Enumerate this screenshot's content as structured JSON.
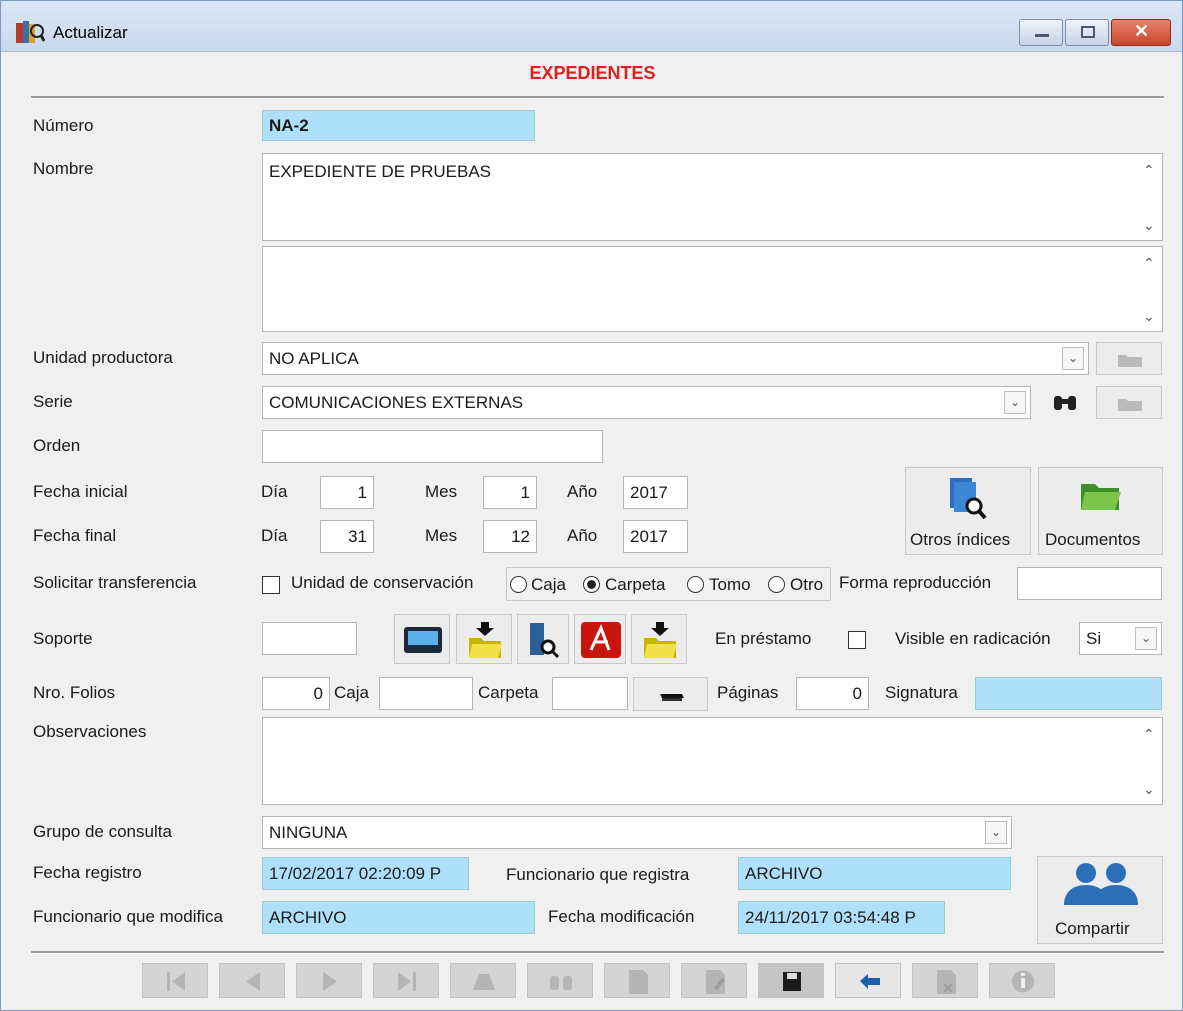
{
  "window": {
    "title": "Actualizar",
    "heading": "EXPEDIENTES"
  },
  "form": {
    "numero_label": "Número",
    "numero_value": "NA-2",
    "nombre_label": "Nombre",
    "nombre_value": "EXPEDIENTE DE PRUEBAS",
    "unidad_label": "Unidad productora",
    "unidad_value": "NO APLICA",
    "serie_label": "Serie",
    "serie_value": "COMUNICACIONES EXTERNAS",
    "orden_label": "Orden",
    "orden_value": "",
    "fecha_inicial_label": "Fecha inicial",
    "fecha_final_label": "Fecha final",
    "dia_label": "Día",
    "mes_label": "Mes",
    "anio_label": "Año",
    "fi_dia": "1",
    "fi_mes": "1",
    "fi_anio": "2017",
    "ff_dia": "31",
    "ff_mes": "12",
    "ff_anio": "2017",
    "otros_indices_label": "Otros índices",
    "documentos_label": "Documentos",
    "solicitar_label": "Solicitar transferencia",
    "unidad_conservacion_label": "Unidad de conservación",
    "radio_caja": "Caja",
    "radio_carpeta": "Carpeta",
    "radio_tomo": "Tomo",
    "radio_otro": "Otro",
    "forma_label": "Forma reproducción",
    "forma_value": "",
    "soporte_label": "Soporte",
    "soporte_value": "",
    "prestamo_label": "En préstamo",
    "visible_label": "Visible en radicación",
    "visible_value": "Si",
    "folios_label": "Nro. Folios",
    "folios_value": "0",
    "caja_label": "Caja",
    "caja_value": "",
    "carpeta_label": "Carpeta",
    "carpeta_value": "",
    "paginas_label": "Páginas",
    "paginas_value": "0",
    "signatura_label": "Signatura",
    "signatura_value": "",
    "observaciones_label": "Observaciones",
    "grupo_label": "Grupo de consulta",
    "grupo_value": "NINGUNA",
    "fecha_registro_label": "Fecha registro",
    "fecha_registro_value": "17/02/2017 02:20:09 P",
    "func_registra_label": "Funcionario que registra",
    "func_registra_value": "ARCHIVO",
    "func_modifica_label": "Funcionario que modifica",
    "func_modifica_value": "ARCHIVO",
    "fecha_mod_label": "Fecha modificación",
    "fecha_mod_value": "24/11/2017 03:54:48 P",
    "compartir_label": "Compartir"
  }
}
